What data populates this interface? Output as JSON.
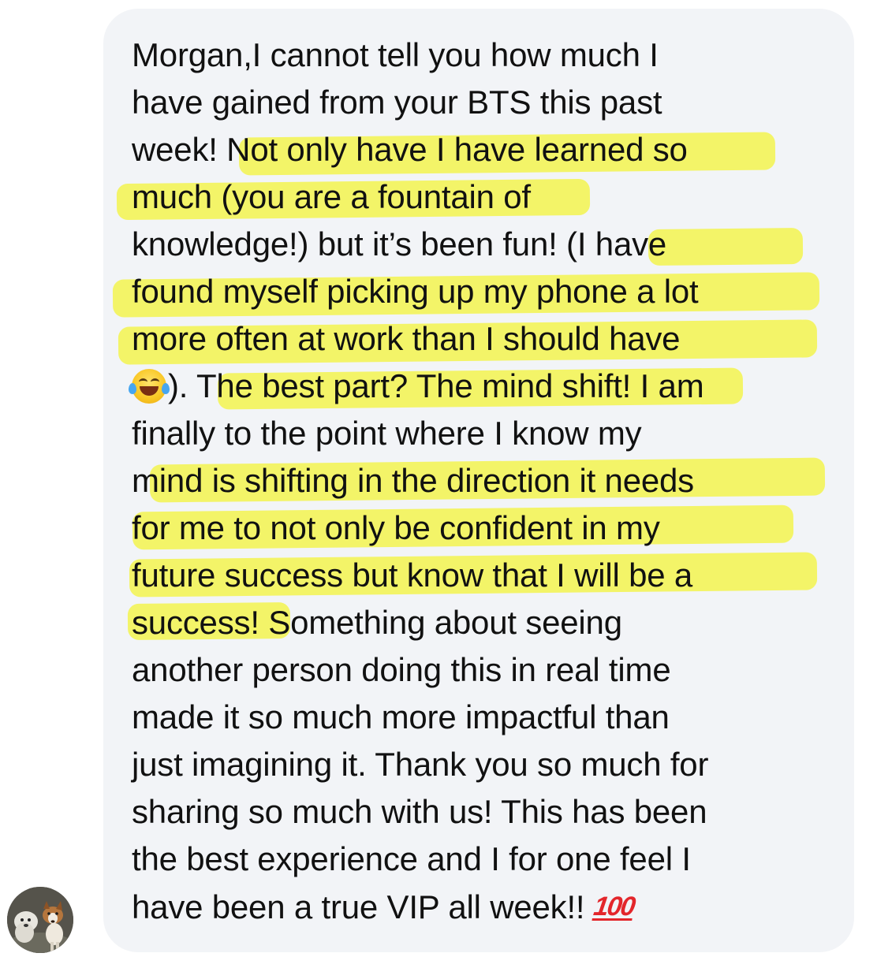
{
  "message": {
    "line1": "Morgan,I cannot tell you how much I",
    "line2": "have gained from your BTS this past",
    "line3": "week! Not only have I have learned so",
    "line4": "much (you are a fountain of",
    "line5": "knowledge!) but it’s been fun! (I have",
    "line6": "found myself picking up my phone a lot",
    "line7": "more often at work than I should have",
    "line8_rest": "). The best part? The mind shift! I am",
    "line9": "finally to the point where I know my",
    "line10": "mind is shifting in the direction it needs",
    "line11": "for me to not only be confident in my",
    "line12": "future success but know that I will be a",
    "line13": "success! Something about seeing",
    "line14": "another person doing this in real time",
    "line15": "made it so much more impactful than",
    "line16": "just imagining it. Thank you so much for",
    "line17": "sharing so much with us! This has been",
    "line18": "the best experience and I for one feel I",
    "line19_text": "have been a true VIP all week!!",
    "emoji_laugh": "face-with-tears-of-joy-emoji",
    "emoji_100_label": "100"
  },
  "colors": {
    "bubble_bg": "#f2f4f7",
    "highlight": "#f4f440",
    "text": "#111111",
    "emoji_100": "#e3262b"
  },
  "avatar": {
    "icon": "dogs-photo-avatar"
  }
}
